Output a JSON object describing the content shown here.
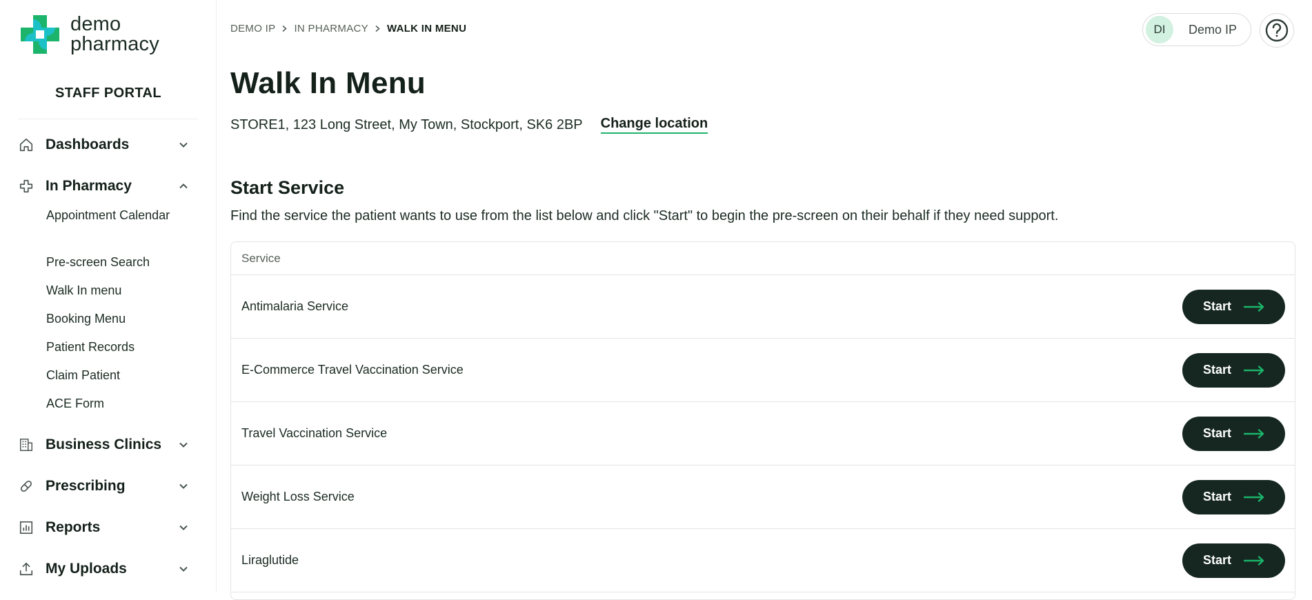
{
  "brand": {
    "name_line1": "demo",
    "name_line2": "pharmacy",
    "portal_title": "STAFF PORTAL",
    "accent_color": "#1bb46a",
    "dark_color": "#152720"
  },
  "sidebar": {
    "groups": [
      {
        "label": "Dashboards",
        "icon": "home-icon",
        "expanded": false
      },
      {
        "label": "In Pharmacy",
        "icon": "medical-cross-icon",
        "expanded": true,
        "items": [
          "Appointment Calendar",
          "Pre-screen Search",
          "Walk In menu",
          "Booking Menu",
          "Patient Records",
          "Claim Patient",
          "ACE Form"
        ]
      },
      {
        "label": "Business Clinics",
        "icon": "building-icon",
        "expanded": false
      },
      {
        "label": "Prescribing",
        "icon": "pill-icon",
        "expanded": false
      },
      {
        "label": "Reports",
        "icon": "bar-chart-icon",
        "expanded": false
      },
      {
        "label": "My Uploads",
        "icon": "upload-icon",
        "expanded": false
      }
    ]
  },
  "header": {
    "breadcrumb": [
      "DEMO IP",
      "IN PHARMACY",
      "WALK IN MENU"
    ],
    "user": {
      "initials": "DI",
      "name": "Demo IP"
    },
    "help_icon": "question-circle-icon"
  },
  "main": {
    "title": "Walk In Menu",
    "location": "STORE1, 123 Long Street, My Town, Stockport, SK6 2BP",
    "change_location_label": "Change location",
    "section_title": "Start Service",
    "section_description": "Find the service the patient wants to use from the list below and click \"Start\" to begin the pre-screen on their behalf if they need support.",
    "table": {
      "header": "Service",
      "start_label": "Start",
      "rows": [
        "Antimalaria Service",
        "E-Commerce Travel Vaccination Service",
        "Travel Vaccination Service",
        "Weight Loss Service",
        "Liraglutide"
      ]
    }
  }
}
